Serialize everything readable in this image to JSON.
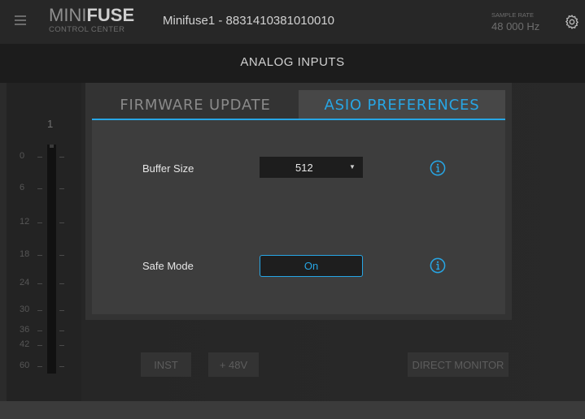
{
  "header": {
    "logo_brand_light": "MINI",
    "logo_brand_bold": "FUSE",
    "logo_sub": "CONTROL CENTER",
    "device_name": "Minifuse1 - 8831410381010010",
    "sample_rate_label": "SAMPLE RATE",
    "sample_rate_value": "48 000 Hz"
  },
  "section": {
    "title": "ANALOG INPUTS"
  },
  "meter": {
    "channel": "1",
    "scale": [
      "0",
      "6",
      "12",
      "18",
      "24",
      "30",
      "36",
      "42",
      "60"
    ]
  },
  "input_controls": {
    "inst_label": "INST",
    "phantom_label": "+ 48V",
    "direct_monitor_label": "DIRECT MONITOR"
  },
  "modal": {
    "tabs": [
      {
        "label": "FIRMWARE UPDATE",
        "active": false
      },
      {
        "label": "ASIO PREFERENCES",
        "active": true
      }
    ],
    "buffer_size_label": "Buffer Size",
    "buffer_size_value": "512",
    "safe_mode_label": "Safe Mode",
    "safe_mode_value": "On"
  },
  "colors": {
    "accent": "#27a6e5",
    "background": "#2b2b2b",
    "modal": "#3d3d3d"
  },
  "icons": {
    "menu": "hamburger-icon",
    "settings": "gear-icon",
    "info": "info-icon",
    "dropdown": "chevron-down-icon"
  }
}
